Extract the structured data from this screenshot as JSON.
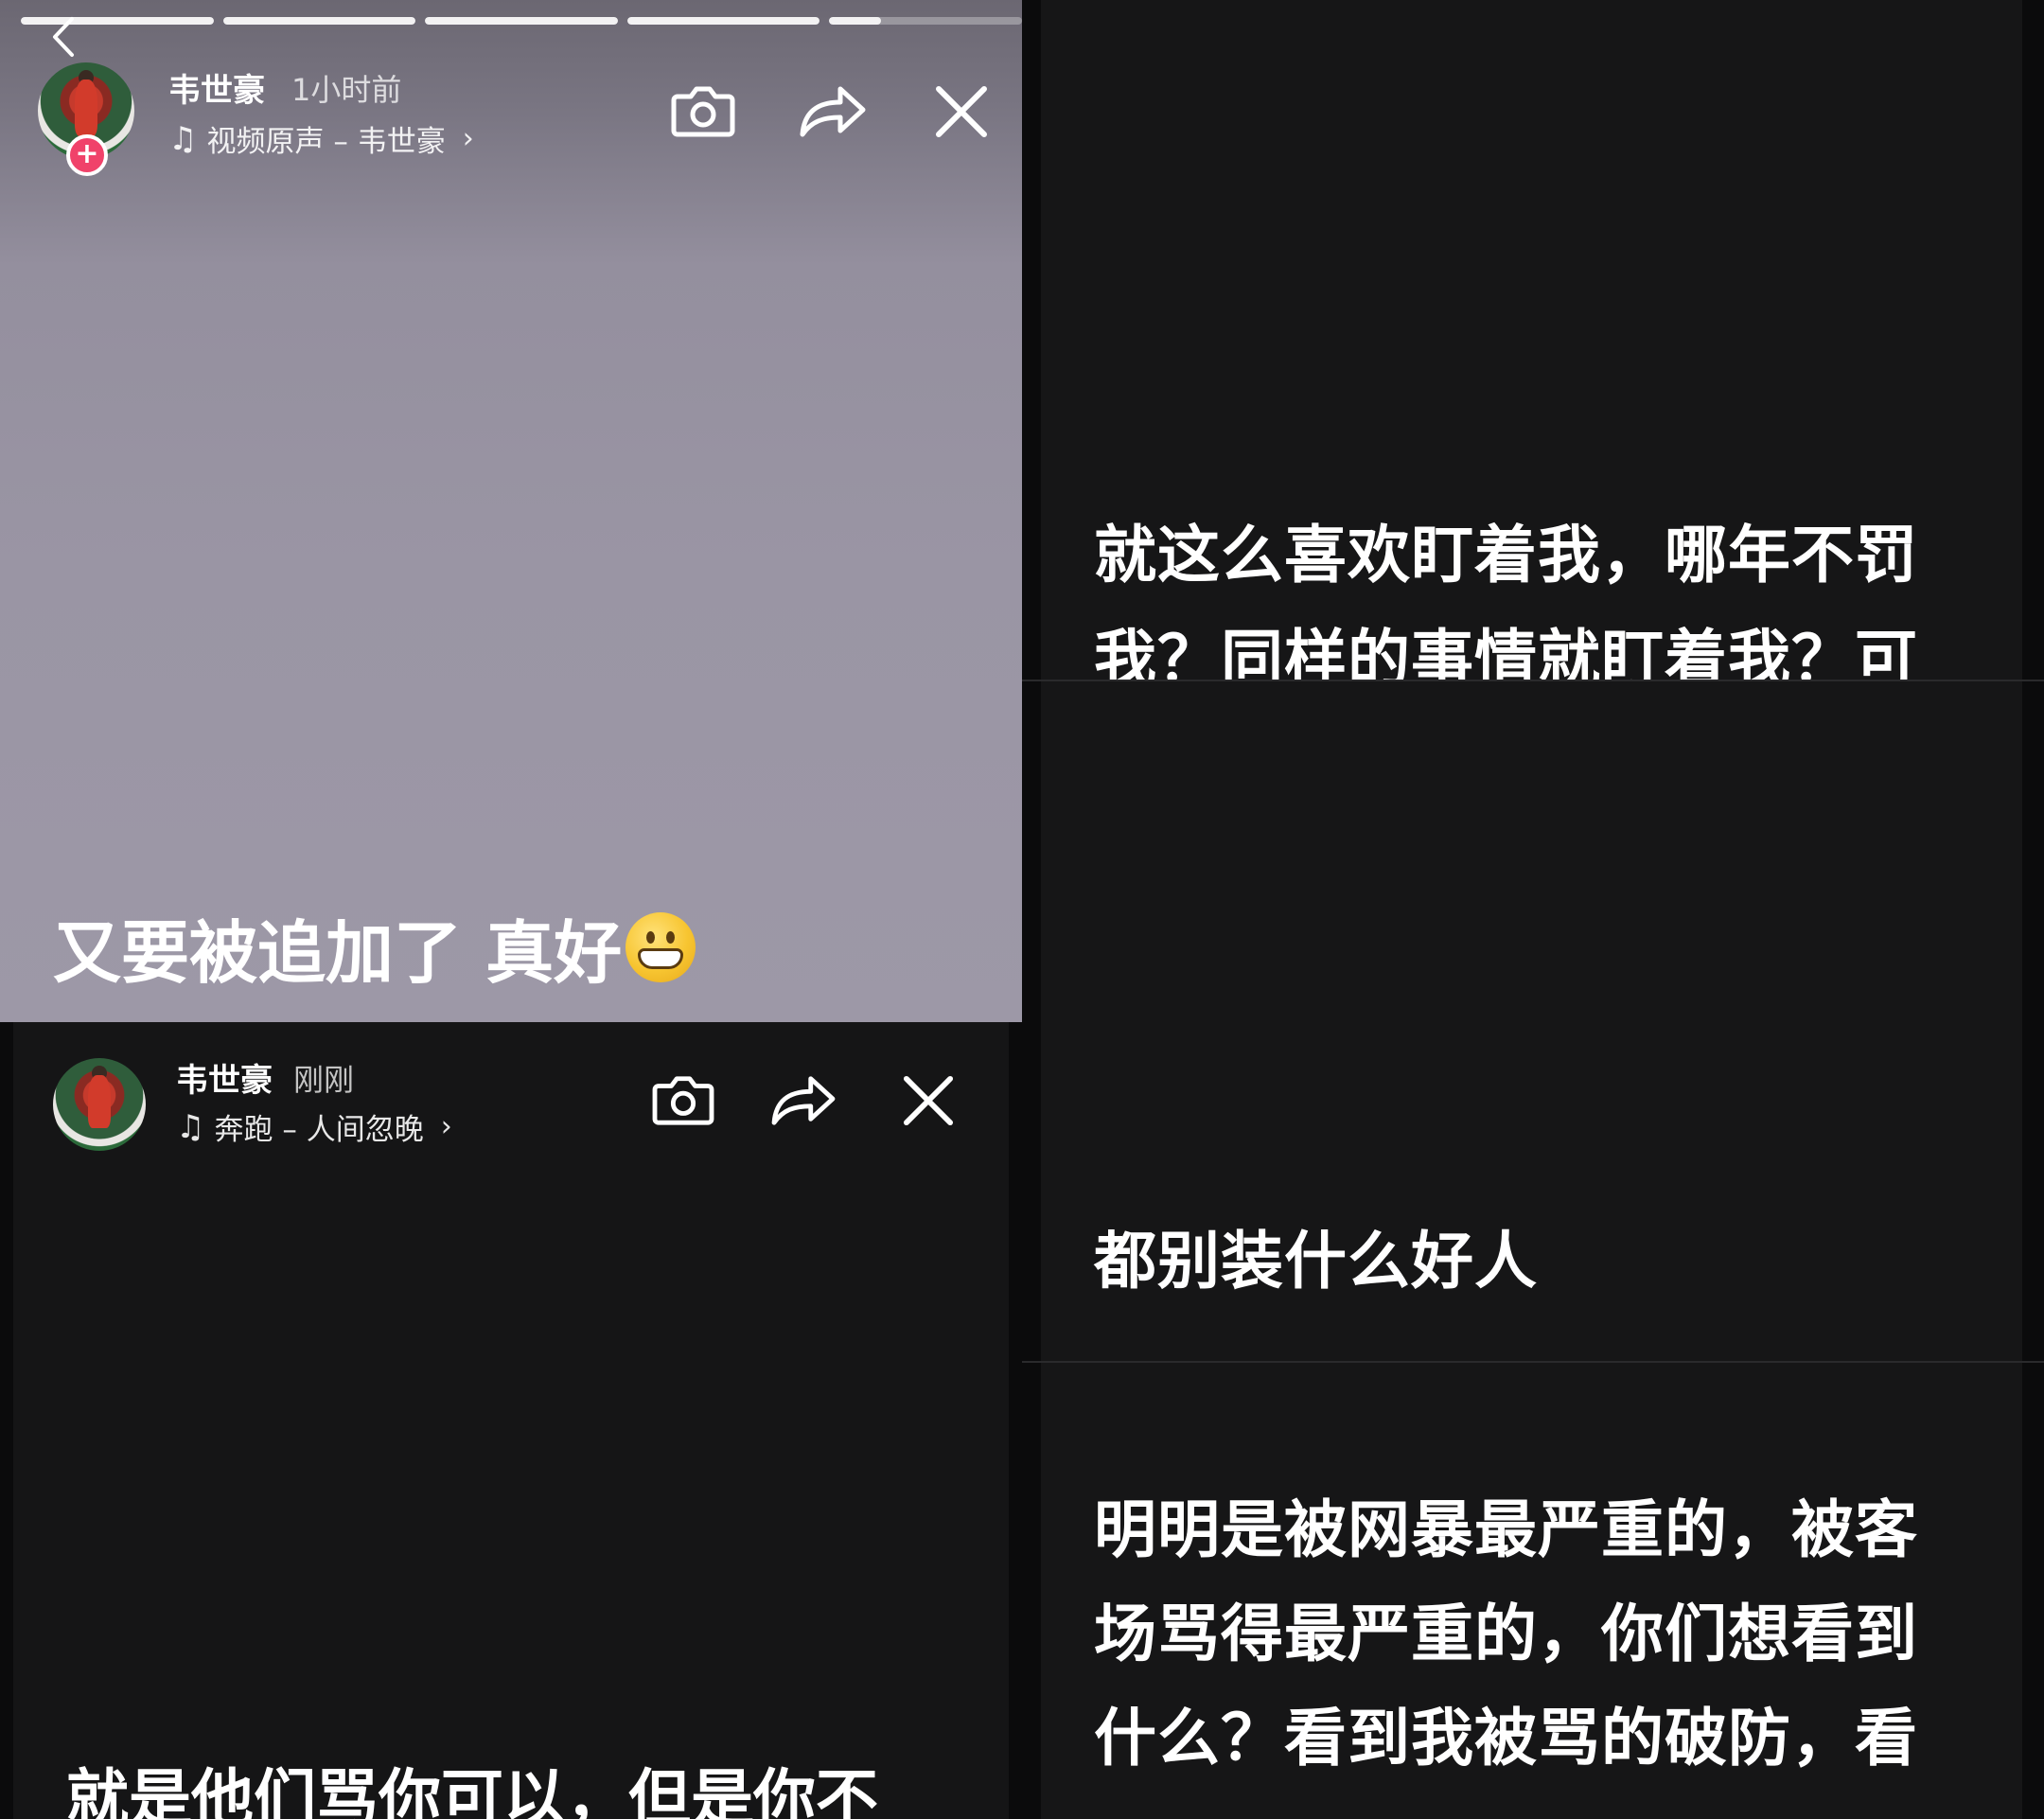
{
  "story1": {
    "user_name": "韦世豪",
    "time": "1小时前",
    "music": "视频原声 – 韦世豪",
    "caption": "又要被追加了 真好",
    "caption_emoji": "grinning-face-emoji",
    "progress_segments": [
      1,
      1,
      1,
      1,
      0.27
    ],
    "colors": {
      "badge": "#f0426a",
      "bg_top": "#6b6772",
      "bg_bottom": "#9d98a7"
    }
  },
  "story2": {
    "user_name": "韦世豪",
    "time": "刚刚",
    "music": "奔跑 – 人间忽晚",
    "caption_partial": "就是他们骂你可以，但是你不"
  },
  "right_panels": {
    "panel1_lines": [
      "就这么喜欢盯着我，哪年不罚",
      "我？同样的事情就盯着我？可"
    ],
    "panel2_lines": [
      "都别装什么好人"
    ],
    "panel3_lines": [
      "明明是被网暴最严重的，被客",
      "场骂得最严重的，你们想看到",
      "什么？看到我被骂的破防，看"
    ]
  },
  "icons": [
    "chevron-left-icon",
    "camera-icon",
    "share-icon",
    "close-icon",
    "music-note-icon",
    "chevron-right-icon",
    "plus-icon"
  ]
}
